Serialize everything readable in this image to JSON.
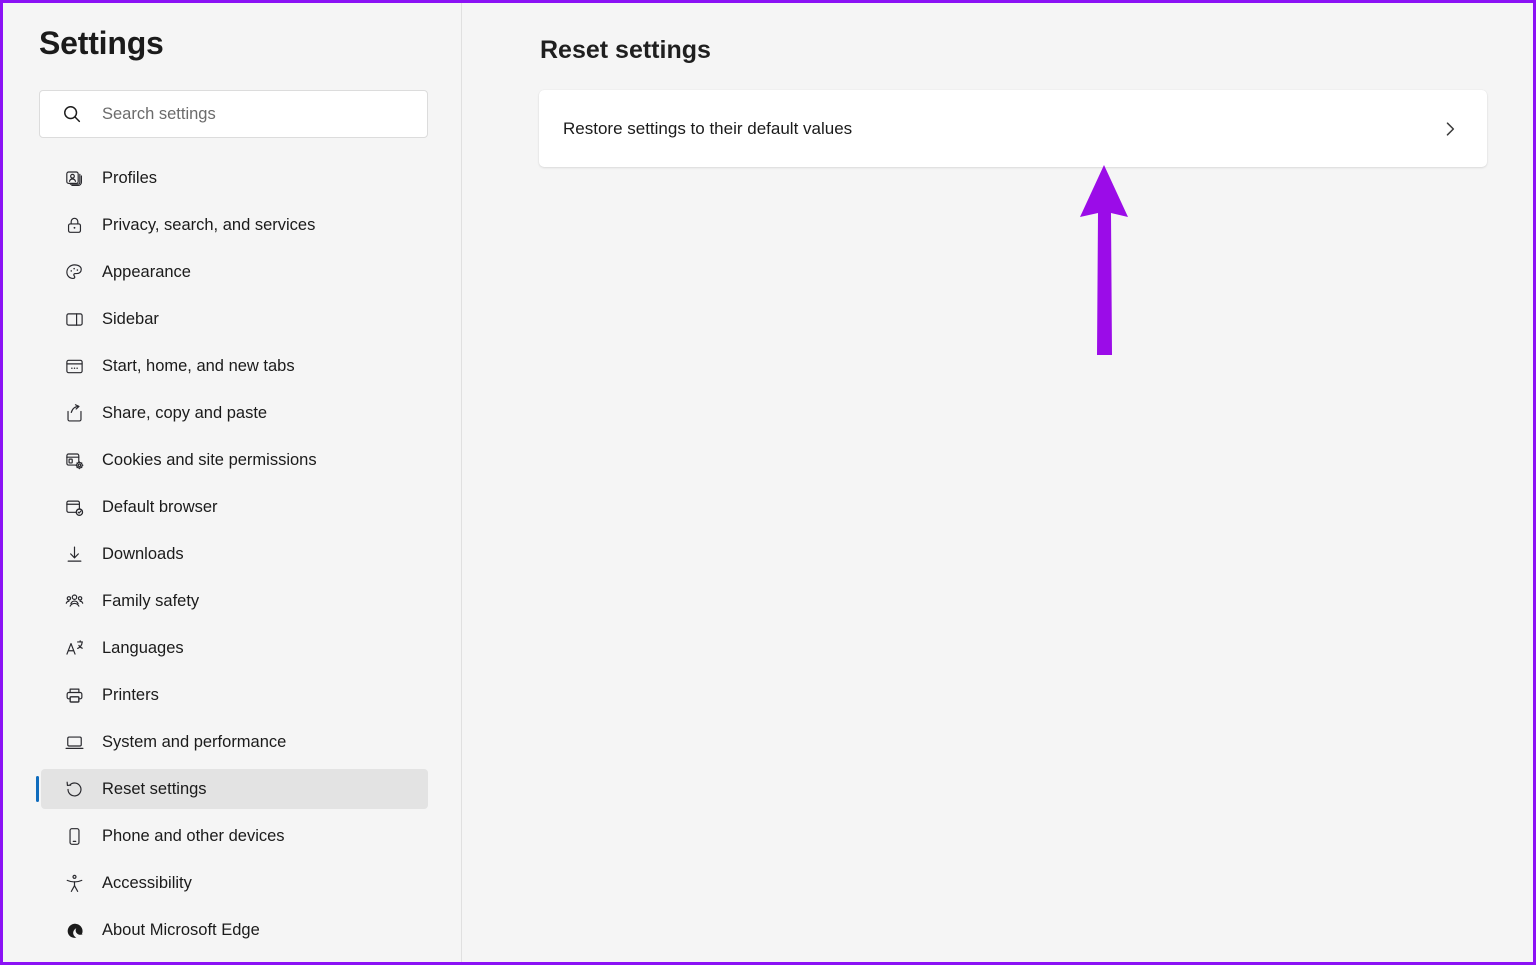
{
  "sidebar": {
    "title": "Settings",
    "search": {
      "placeholder": "Search settings",
      "value": "",
      "icon": "search-icon"
    },
    "items": [
      {
        "label": "Profiles",
        "icon": "profiles-icon",
        "selected": false
      },
      {
        "label": "Privacy, search, and services",
        "icon": "lock-icon",
        "selected": false
      },
      {
        "label": "Appearance",
        "icon": "palette-icon",
        "selected": false
      },
      {
        "label": "Sidebar",
        "icon": "sidebar-panel-icon",
        "selected": false
      },
      {
        "label": "Start, home, and new tabs",
        "icon": "browser-window-icon",
        "selected": false
      },
      {
        "label": "Share, copy and paste",
        "icon": "share-icon",
        "selected": false
      },
      {
        "label": "Cookies and site permissions",
        "icon": "cookies-gear-icon",
        "selected": false
      },
      {
        "label": "Default browser",
        "icon": "default-browser-icon",
        "selected": false
      },
      {
        "label": "Downloads",
        "icon": "download-arrow-icon",
        "selected": false
      },
      {
        "label": "Family safety",
        "icon": "people-group-icon",
        "selected": false
      },
      {
        "label": "Languages",
        "icon": "languages-icon",
        "selected": false
      },
      {
        "label": "Printers",
        "icon": "printer-icon",
        "selected": false
      },
      {
        "label": "System and performance",
        "icon": "laptop-icon",
        "selected": false
      },
      {
        "label": "Reset settings",
        "icon": "reset-arrow-icon",
        "selected": true
      },
      {
        "label": "Phone and other devices",
        "icon": "phone-icon",
        "selected": false
      },
      {
        "label": "Accessibility",
        "icon": "accessibility-icon",
        "selected": false
      },
      {
        "label": "About Microsoft Edge",
        "icon": "edge-logo-icon",
        "selected": false
      }
    ]
  },
  "main": {
    "heading": "Reset settings",
    "restore_card": {
      "label": "Restore settings to their default values",
      "chevron_icon": "chevron-right-icon"
    }
  },
  "annotation": {
    "arrow": {
      "direction": "up",
      "color": "#9B0CE8",
      "points_to": "restore-settings-card"
    }
  },
  "colors": {
    "page_background": "#F5F5F5",
    "card_background": "#FFFFFF",
    "selected_item_background": "#E3E3E3",
    "selection_accent": "#0F6CBD",
    "text_primary": "#1B1B1B",
    "text_placeholder": "#6B6B6B",
    "frame_border": "#8B12F5",
    "annotation_purple": "#9B0CE8"
  }
}
